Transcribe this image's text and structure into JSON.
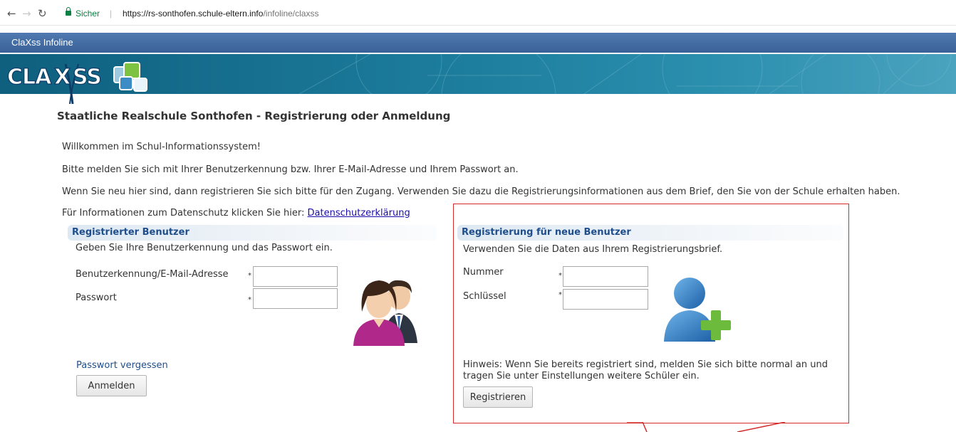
{
  "browser": {
    "secure_label": "Sicher",
    "url_host": "https://rs-sonthofen.schule-eltern.info",
    "url_path": "/infoline/claxss"
  },
  "app": {
    "title": "ClaXss Infoline",
    "logo_text": "CLAXSS"
  },
  "page": {
    "heading": "Staatliche Realschule Sonthofen - Registrierung oder Anmeldung",
    "welcome": "Willkommen im Schul-Informationssystem!",
    "instruction": "Bitte melden Sie sich mit Ihrer Benutzerkennung bzw. Ihrer E-Mail-Adresse und Ihrem Passwort an.",
    "new_user_info": "Wenn Sie neu hier sind, dann registrieren Sie sich bitte für den Zugang. Verwenden Sie dazu die Registrierungsinformationen aus dem Brief, den Sie von der Schule erhalten haben.",
    "privacy_text": "Für Informationen zum Datenschutz klicken Sie hier:",
    "privacy_link": "Datenschutzerklärung"
  },
  "login": {
    "heading": "Registrierter Benutzer",
    "subtitle": "Geben Sie Ihre Benutzerkennung und das Passwort ein.",
    "user_label": "Benutzerkennung/E-Mail-Adresse",
    "user_value": "",
    "password_label": "Passwort",
    "password_value": "",
    "required_mark": "*",
    "forgot_link": "Passwort vergessen",
    "submit_label": "Anmelden"
  },
  "register": {
    "heading": "Registrierung für neue Benutzer",
    "subtitle": "Verwenden Sie die Daten aus Ihrem Registrierungsbrief.",
    "number_label": "Nummer",
    "number_value": "",
    "key_label": "Schlüssel",
    "key_value": "",
    "required_mark": "*",
    "hint": "Hinweis: Wenn Sie bereits registriert sind, melden Sie sich bitte normal an und tragen Sie unter Einstellungen weitere Schüler ein.",
    "submit_label": "Registrieren"
  },
  "colors": {
    "accent": "#1f4e8c",
    "header_bar": "#3a6298",
    "banner": "#1c7b9b",
    "highlight_box": "#d42b2b"
  },
  "icons": [
    "back-arrow-icon",
    "forward-arrow-icon",
    "reload-icon",
    "lock-icon",
    "users-icon",
    "add-user-icon"
  ]
}
